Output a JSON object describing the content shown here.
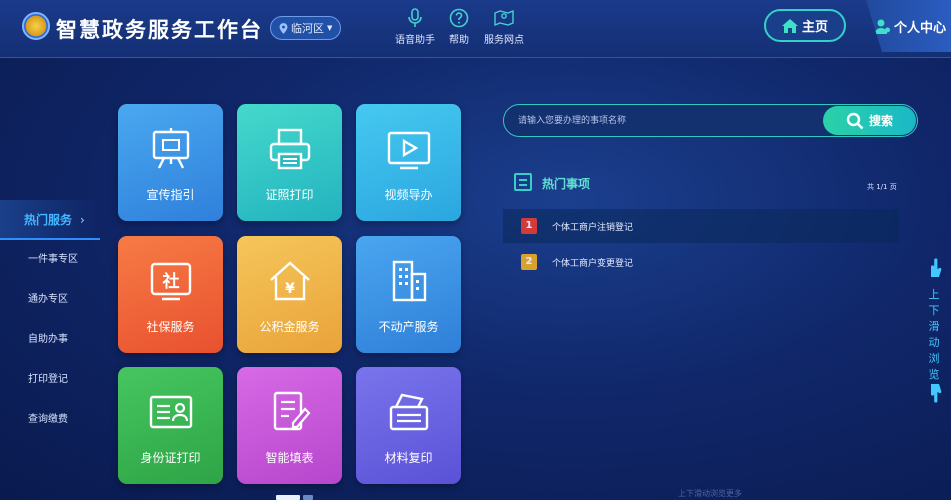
{
  "header": {
    "title": "智慧政务服务工作台",
    "region": "临河区",
    "tools": [
      {
        "label": "语音助手",
        "icon": "microphone-icon"
      },
      {
        "label": "帮助",
        "icon": "question-icon"
      },
      {
        "label": "服务网点",
        "icon": "map-pin-icon"
      }
    ],
    "home_label": "主页",
    "user_label": "个人中心"
  },
  "leftnav": {
    "items": [
      {
        "label": "热门服务",
        "active": true
      },
      {
        "label": "一件事专区"
      },
      {
        "label": "通办专区"
      },
      {
        "label": "自助办事"
      },
      {
        "label": "打印登记"
      },
      {
        "label": "查询缴费"
      }
    ]
  },
  "tiles": [
    {
      "label": "宣传指引",
      "icon": "easel-icon",
      "color": "#3f9be8"
    },
    {
      "label": "证照打印",
      "icon": "printer-icon",
      "color": "#33c9c4"
    },
    {
      "label": "视频导办",
      "icon": "video-play-icon",
      "color": "#35b9e6"
    },
    {
      "label": "社保服务",
      "icon": "social-security-icon",
      "color": "#f06a3e"
    },
    {
      "label": "公积金服务",
      "icon": "house-yuan-icon",
      "color": "#f0b84a"
    },
    {
      "label": "不动产服务",
      "icon": "buildings-icon",
      "color": "#3c8fe0"
    },
    {
      "label": "身份证打印",
      "icon": "id-card-icon",
      "color": "#3cb54f"
    },
    {
      "label": "智能填表",
      "icon": "form-pen-icon",
      "color": "#c85ad8"
    },
    {
      "label": "材料复印",
      "icon": "copier-icon",
      "color": "#6a65e0"
    }
  ],
  "search": {
    "placeholder": "请输入您要办理的事项名称",
    "button_label": "搜索"
  },
  "hot": {
    "title": "热门事项",
    "page": "共 1/1 页",
    "items": [
      {
        "rank": "1",
        "label": "个体工商户注销登记",
        "rank_color": "#d33b3b"
      },
      {
        "rank": "2",
        "label": "个体工商户变更登记",
        "rank_color": "#d9a22e"
      }
    ]
  },
  "scroll_hint": {
    "chars": [
      "上",
      "下",
      "滑",
      "动",
      "浏",
      "览"
    ]
  },
  "footer_text": "上下滑动浏览更多"
}
